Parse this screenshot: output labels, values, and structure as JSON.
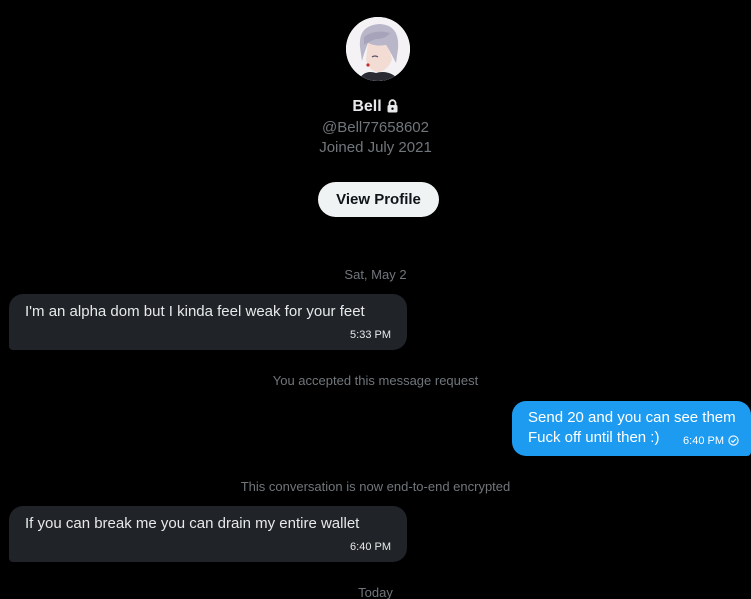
{
  "profile": {
    "name": "Bell",
    "handle": "@Bell77658602",
    "joined": "Joined July 2021",
    "view_profile_label": "View Profile",
    "avatar_icon": "anime-avatar-icon",
    "lock_icon": "lock-icon"
  },
  "conversation": {
    "date_1": "Sat, May 2",
    "accepted_text": "You accepted this message request",
    "encrypted_text": "This conversation is now end-to-end encrypted",
    "date_2": "Today",
    "messages": [
      {
        "direction": "incoming",
        "lines": [
          "I'm an alpha dom but I kinda feel weak for your feet"
        ],
        "time": "5:33 PM"
      },
      {
        "direction": "outgoing",
        "lines": [
          "Send 20 and you can see them",
          "Fuck off until then :)"
        ],
        "time": "6:40 PM",
        "status_icon": "sent-check-icon"
      },
      {
        "direction": "incoming",
        "lines": [
          "If you can break me you can drain my entire wallet"
        ],
        "time": "6:40 PM"
      }
    ]
  },
  "colors": {
    "background": "#000000",
    "incoming_bubble": "#202327",
    "outgoing_bubble": "#1d9bf0",
    "muted_text": "#71767b",
    "primary_text": "#e7e9ea",
    "button_bg": "#eff3f4"
  }
}
